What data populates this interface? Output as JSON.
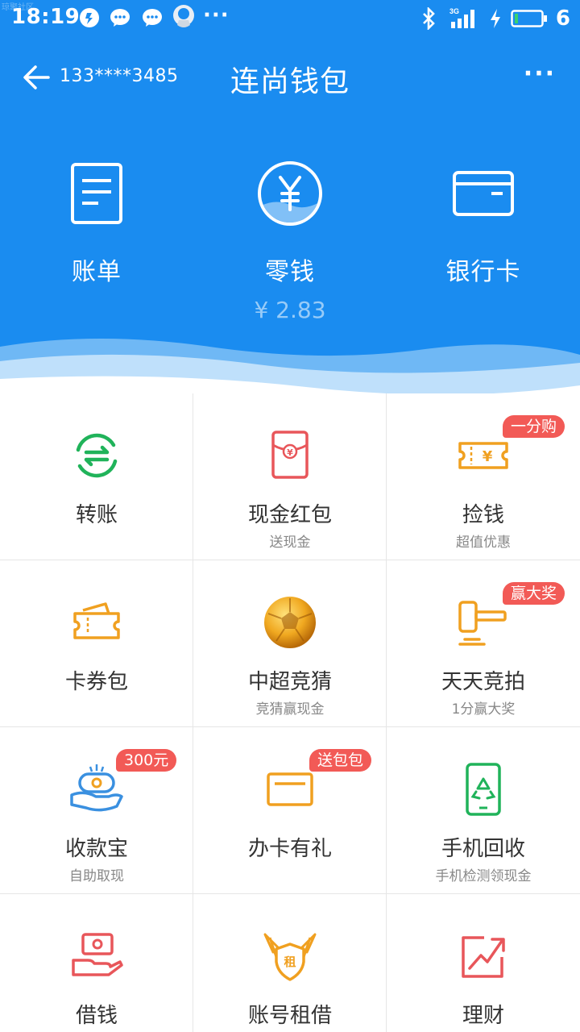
{
  "watermark": "琼聚社区",
  "status_bar": {
    "time": "18:19",
    "network": "3G",
    "battery_level": "6",
    "icons": [
      "app-notification-icon",
      "wechat-icon",
      "wechat-icon",
      "qq-icon",
      "more-notifications-icon",
      "bluetooth-icon",
      "signal-icon",
      "charging-icon",
      "battery-icon"
    ]
  },
  "title_bar": {
    "account": "133****3485",
    "title": "连尚钱包",
    "more": "···"
  },
  "top_features": [
    {
      "label": "账单",
      "icon": "bill-icon"
    },
    {
      "label": "零钱",
      "icon": "yuan-coin-icon",
      "amount": "¥ 2.83"
    },
    {
      "label": "银行卡",
      "icon": "bank-card-icon"
    }
  ],
  "services": [
    {
      "label": "转账",
      "subtitle": "",
      "badge": "",
      "icon": "transfer-icon"
    },
    {
      "label": "现金红包",
      "subtitle": "送现金",
      "badge": "",
      "icon": "red-envelope-icon"
    },
    {
      "label": "捡钱",
      "subtitle": "超值优惠",
      "badge": "一分购",
      "icon": "coupon-ticket-icon"
    },
    {
      "label": "卡券包",
      "subtitle": "",
      "badge": "",
      "icon": "card-wallet-icon"
    },
    {
      "label": "中超竞猜",
      "subtitle": "竞猜赢现金",
      "badge": "",
      "icon": "soccer-ball-icon"
    },
    {
      "label": "天天竞拍",
      "subtitle": "1分赢大奖",
      "badge": "赢大奖",
      "icon": "auction-hammer-icon"
    },
    {
      "label": "收款宝",
      "subtitle": "自助取现",
      "badge": "300元",
      "icon": "receive-money-icon"
    },
    {
      "label": "办卡有礼",
      "subtitle": "",
      "badge": "送包包",
      "icon": "credit-card-gift-icon"
    },
    {
      "label": "手机回收",
      "subtitle": "手机检测领现金",
      "badge": "",
      "icon": "phone-recycle-icon"
    },
    {
      "label": "借钱",
      "subtitle": "",
      "badge": "",
      "icon": "borrow-money-icon"
    },
    {
      "label": "账号租借",
      "subtitle": "",
      "badge": "",
      "icon": "account-rental-icon"
    },
    {
      "label": "理财",
      "subtitle": "",
      "badge": "",
      "icon": "finance-chart-icon"
    }
  ],
  "colors": {
    "header_blue": "#1a8cf0",
    "green": "#20b35a",
    "red": "#e8565a",
    "orange": "#f0a020",
    "badge": "#f25a56",
    "blue_icon": "#3a90e0"
  }
}
